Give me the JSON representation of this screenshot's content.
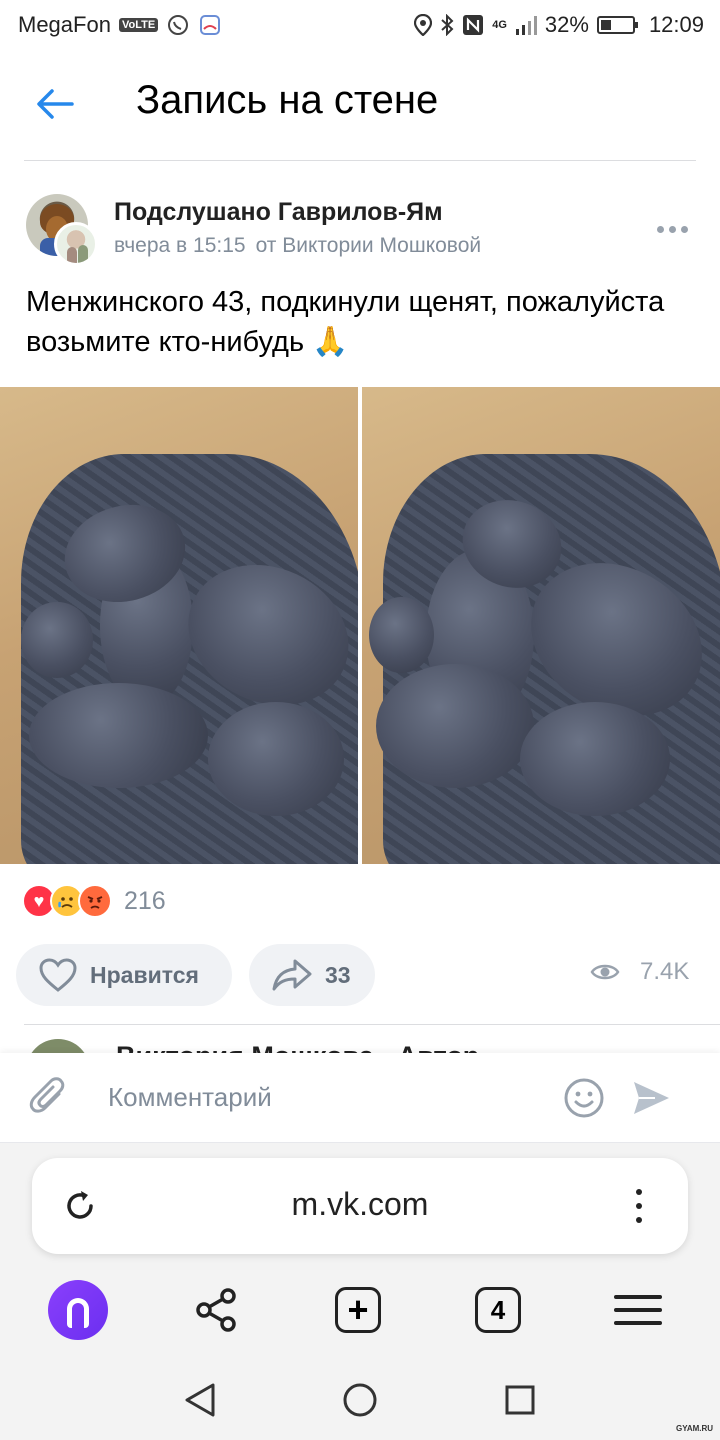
{
  "status_bar": {
    "carrier": "MegaFon",
    "volte": "VoLTE",
    "network": "4G",
    "battery": "32%",
    "battery_level": 0.32,
    "time": "12:09"
  },
  "header": {
    "title": "Запись на стене"
  },
  "post": {
    "group_name": "Подслушано Гаврилов-Ям",
    "time": "вчера в 15:15",
    "author": "от Виктории Мошковой",
    "text": "Менжинского 43, подкинули щенят, пожалуйста возьмите кто-нибудь 🙏",
    "reactions": {
      "emojis": [
        "heart",
        "crying-face",
        "angry-face"
      ],
      "count": "216"
    },
    "like_label": "Нравится",
    "share_count": "33",
    "views": "7.4K"
  },
  "next_comment": {
    "author_label": "Виктория Мошкова · Автор"
  },
  "comment_bar": {
    "placeholder": "Комментарий"
  },
  "browser": {
    "url": "m.vk.com",
    "tab_count": "4",
    "new_tab_symbol": "+"
  },
  "watermark": "GYAM.RU",
  "colors": {
    "accent": "#2688eb",
    "secondary_text": "#818c99",
    "button_bg": "#f0f2f5",
    "alice": "#7b36f5"
  }
}
